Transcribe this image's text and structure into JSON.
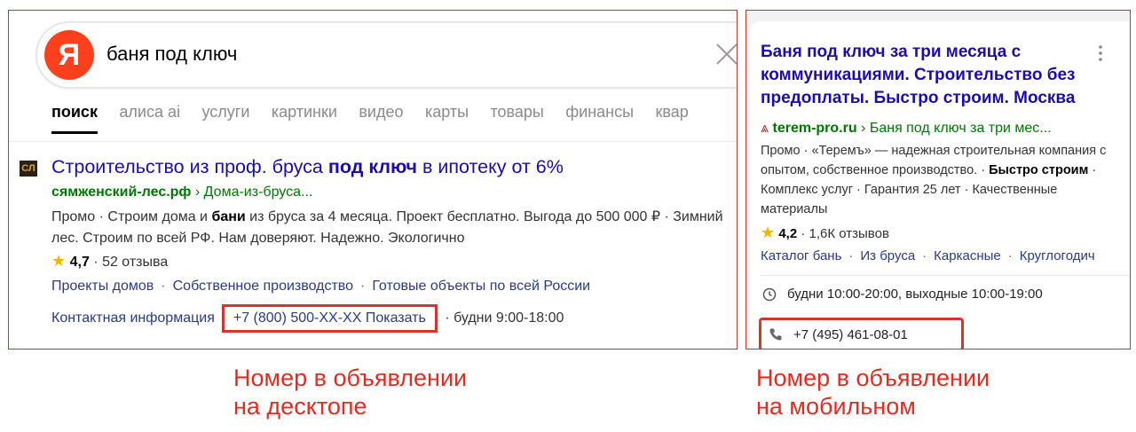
{
  "desktop": {
    "logo_letter": "Я",
    "query": "баня под ключ",
    "tabs": [
      "поиск",
      "алиса ai",
      "услуги",
      "картинки",
      "видео",
      "карты",
      "товары",
      "финансы",
      "квар"
    ],
    "favicon_text": "СЛ",
    "ad": {
      "title_part1": "Строительство из проф. бруса ",
      "title_bold": "под ключ",
      "title_part2": " в ипотеку от 6%",
      "domain": "сямженский-лес.рф",
      "path": " › Дома-из-бруса...",
      "text_part1": "Промо · Строим дома и ",
      "text_bold": "бани",
      "text_part2": " из бруса за 4 месяца. Проект бесплатно. Выгода до 500 000 ₽ · Зимний лес. Строим по всей РФ. Нам доверяют. Надежно. Экологично",
      "rating": "4,7",
      "reviews": " · 52 отзыва",
      "sitelinks": [
        "Проекты домов",
        "Собственное производство",
        "Готовые объекты по всей России"
      ],
      "contacts_label": "Контактная информация",
      "phone": "+7 (800) 500-XX-XX Показать",
      "hours": " · будни 9:00-18:00"
    }
  },
  "mobile": {
    "title_bold": "Баня под ключ",
    "title_rest": " за три месяца с коммуникациями. Строительство без предоплаты. Быстро строим. Москва",
    "domain": "terem-pro.ru",
    "path": " › Баня под ключ за три мес...",
    "text_part1": "Промо · «Теремъ» — надежная строительная компания с опытом, собственное производство. · ",
    "text_bold": "Быстро строим",
    "text_part2": " · Комплекс услуг · Гарантия 25 лет · Качественные материалы",
    "rating": "4,2",
    "reviews": " · 1,6К отзывов",
    "sitelinks": [
      "Каталог бань",
      "Из бруса",
      "Каркасные",
      "Круглогодич"
    ],
    "hours": "будни 10:00-20:00, выходные 10:00-19:00",
    "phone": "+7 (495) 461-08-01"
  },
  "captions": {
    "desktop": [
      "Номер в объявлении",
      "на десктопе"
    ],
    "mobile": [
      "Номер в объявлении",
      "на мобильном"
    ]
  },
  "colors": {
    "highlight": "#d9342b",
    "caption": "#e62a1d",
    "link": "#1a0dab",
    "url": "#007700",
    "yandex": "#fc3f1d"
  }
}
